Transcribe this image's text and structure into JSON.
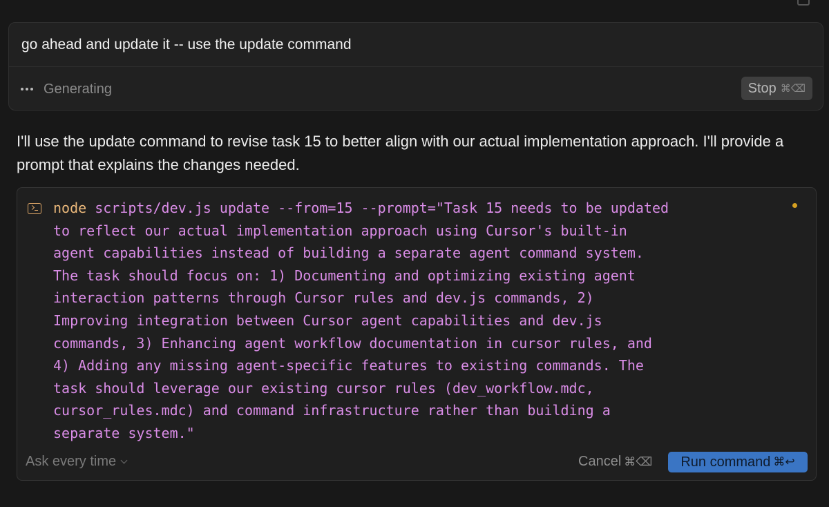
{
  "prompt": {
    "text": "go ahead and update it -- use the update command",
    "status_label": "Generating",
    "stop_label": "Stop",
    "stop_shortcut": "⌘⌫"
  },
  "assistant": {
    "message": "I'll use the update command to revise task 15 to better align with our actual implementation approach. I'll provide a prompt that explains the changes needed."
  },
  "command": {
    "keyword": "node",
    "lines": [
      " scripts/dev.js update --from=15 --prompt=\"Task 15 needs to be updated",
      "to reflect our actual implementation approach using Cursor's built-in",
      "agent capabilities instead of building a separate agent command system.",
      "The task should focus on: 1) Documenting and optimizing existing agent",
      "interaction patterns through Cursor rules and dev.js commands, 2)",
      "Improving integration between Cursor agent capabilities and dev.js",
      "commands, 3) Enhancing agent workflow documentation in cursor rules, and",
      "4) Adding any missing agent-specific features to existing commands. The",
      "task should leverage our existing cursor rules (dev_workflow.mdc,",
      "cursor_rules.mdc) and command infrastructure rather than building a",
      "separate system.\""
    ],
    "approval_mode": "Ask every time",
    "cancel_label": "Cancel",
    "cancel_shortcut": "⌘⌫",
    "run_label": "Run command",
    "run_shortcut": "⌘↩"
  },
  "colors": {
    "background": "#181818",
    "command_text": "#d98ce6",
    "command_keyword": "#e9b77a",
    "run_button": "#3a75c4",
    "status_dot": "#d6a021"
  },
  "icons": [
    "copy-icon",
    "generating-dots-icon",
    "terminal-icon",
    "status-dot-icon",
    "chevron-down-icon"
  ]
}
